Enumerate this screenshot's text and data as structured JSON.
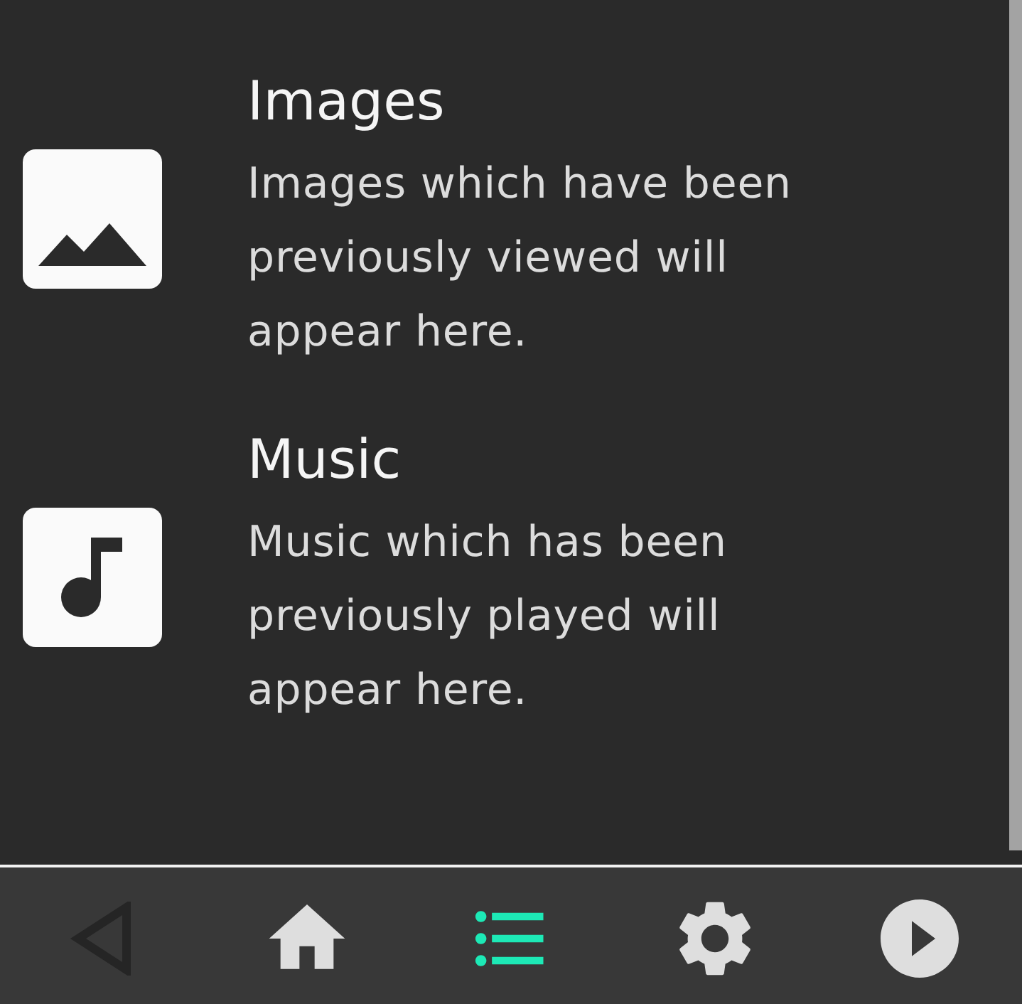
{
  "sections": [
    {
      "kind": "images",
      "title": "Images",
      "description": "Images which have been previously viewed will appear here."
    },
    {
      "kind": "music",
      "title": "Music",
      "description": "Music which has been previously played will appear here."
    }
  ],
  "nav": [
    {
      "kind": "back",
      "selected": false,
      "disabled": true
    },
    {
      "kind": "home",
      "selected": false,
      "disabled": false
    },
    {
      "kind": "list",
      "selected": true,
      "disabled": false
    },
    {
      "kind": "settings",
      "selected": false,
      "disabled": false
    },
    {
      "kind": "play",
      "selected": false,
      "disabled": false
    }
  ]
}
